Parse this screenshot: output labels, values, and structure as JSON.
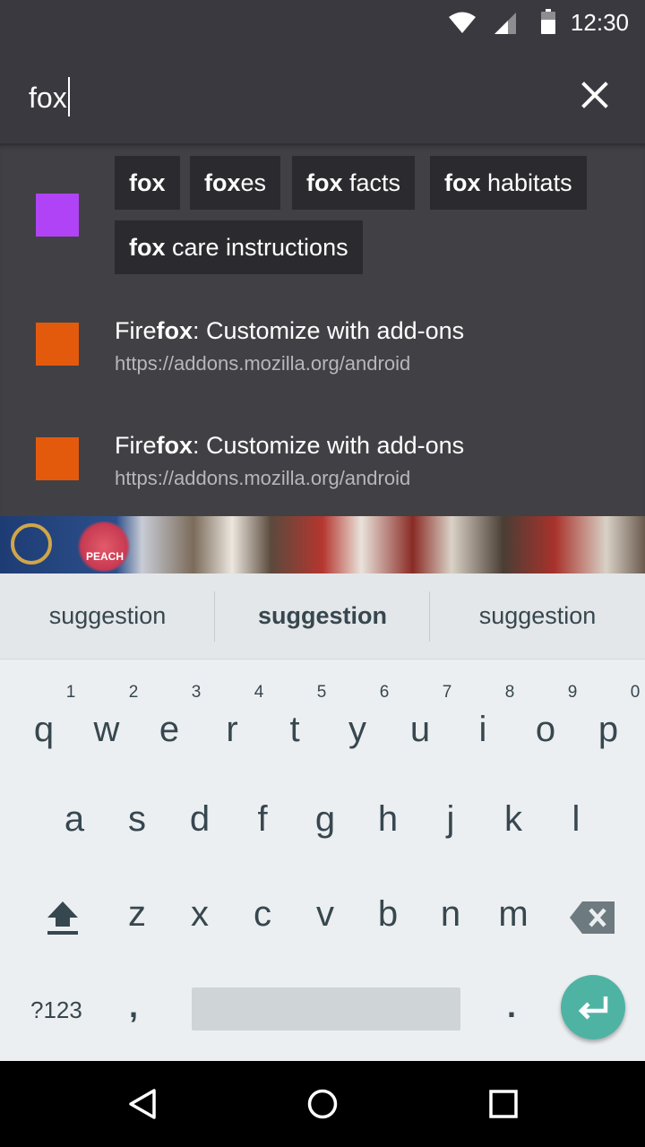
{
  "status_bar": {
    "time": "12:30",
    "icons": [
      "wifi-icon",
      "signal-icon",
      "battery-icon"
    ]
  },
  "url_bar": {
    "value": "fox",
    "clear_icon": "close-icon"
  },
  "search_suggestions": {
    "icon_color": "#b043f5",
    "chips": [
      {
        "bold": "fox",
        "rest": ""
      },
      {
        "bold": "fox",
        "rest": "es"
      },
      {
        "bold": "fox",
        "rest": " facts"
      },
      {
        "bold": "fox",
        "rest": " habitats"
      },
      {
        "bold": "fox",
        "rest": " care instructions"
      }
    ]
  },
  "history": [
    {
      "title_pre": "Fire",
      "title_bold": "fox",
      "title_post": ": Customize with add-ons",
      "url": "https://addons.mozilla.org/android",
      "icon_color": "#e45a0d"
    },
    {
      "title_pre": "Fire",
      "title_bold": "fox",
      "title_post": ": Customize with add-ons",
      "url": "https://addons.mozilla.org/android",
      "icon_color": "#e45a0d"
    }
  ],
  "web_content": {
    "logo_text": "PEACH"
  },
  "keyboard": {
    "suggestions": [
      "suggestion",
      "suggestion",
      "suggestion"
    ],
    "row1": [
      "q",
      "w",
      "e",
      "r",
      "t",
      "y",
      "u",
      "i",
      "o",
      "p"
    ],
    "row1_hints": [
      "1",
      "2",
      "3",
      "4",
      "5",
      "6",
      "7",
      "8",
      "9",
      "0"
    ],
    "row2": [
      "a",
      "s",
      "d",
      "f",
      "g",
      "h",
      "j",
      "k",
      "l"
    ],
    "row3": [
      "z",
      "x",
      "c",
      "v",
      "b",
      "n",
      "m"
    ],
    "symbols_label": "?123",
    "comma": ",",
    "period": ".",
    "accent_color": "#4fb3a4"
  },
  "nav_bar": {
    "icons": [
      "back-icon",
      "home-icon",
      "recents-icon"
    ]
  }
}
